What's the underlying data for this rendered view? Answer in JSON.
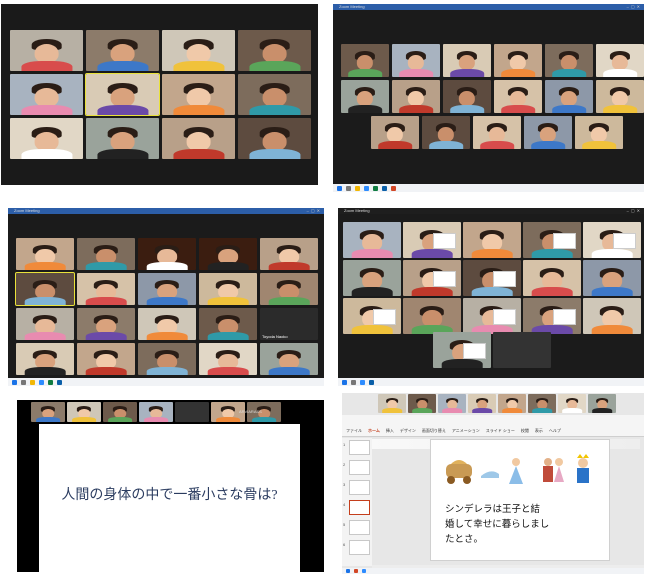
{
  "panel2": {
    "title": "Zoom Meeting"
  },
  "panel3": {
    "title": "Zoom Meeting",
    "named_participant": "Toyoda Naoko",
    "named_participant_small": "Toyoda Naoko"
  },
  "panel4": {
    "title": "Zoom Meeting"
  },
  "panel5": {
    "sharing_label": "ARVIARASS",
    "question": "人間の身体の中で一番小さな骨は?"
  },
  "panel6": {
    "ribbon_tabs": [
      "ファイル",
      "ホーム",
      "挿入",
      "デザイン",
      "画面切り替え",
      "アニメーション",
      "スライド ショー",
      "校閲",
      "表示",
      "ヘルプ"
    ],
    "story_line1": "シンデレラは王子と結",
    "story_line2": "婚して幸せに暮らしまし",
    "story_line3": "たとさ。",
    "slide_numbers": [
      "1",
      "2",
      "3",
      "4",
      "5",
      "6"
    ]
  },
  "colors": {
    "zoom_dark": "#1a1a1a",
    "zoom_light": "#232323",
    "active_speaker": "#e9e23a",
    "ppt_accent": "#c43e1c",
    "slide_text": "#2b3c60"
  }
}
